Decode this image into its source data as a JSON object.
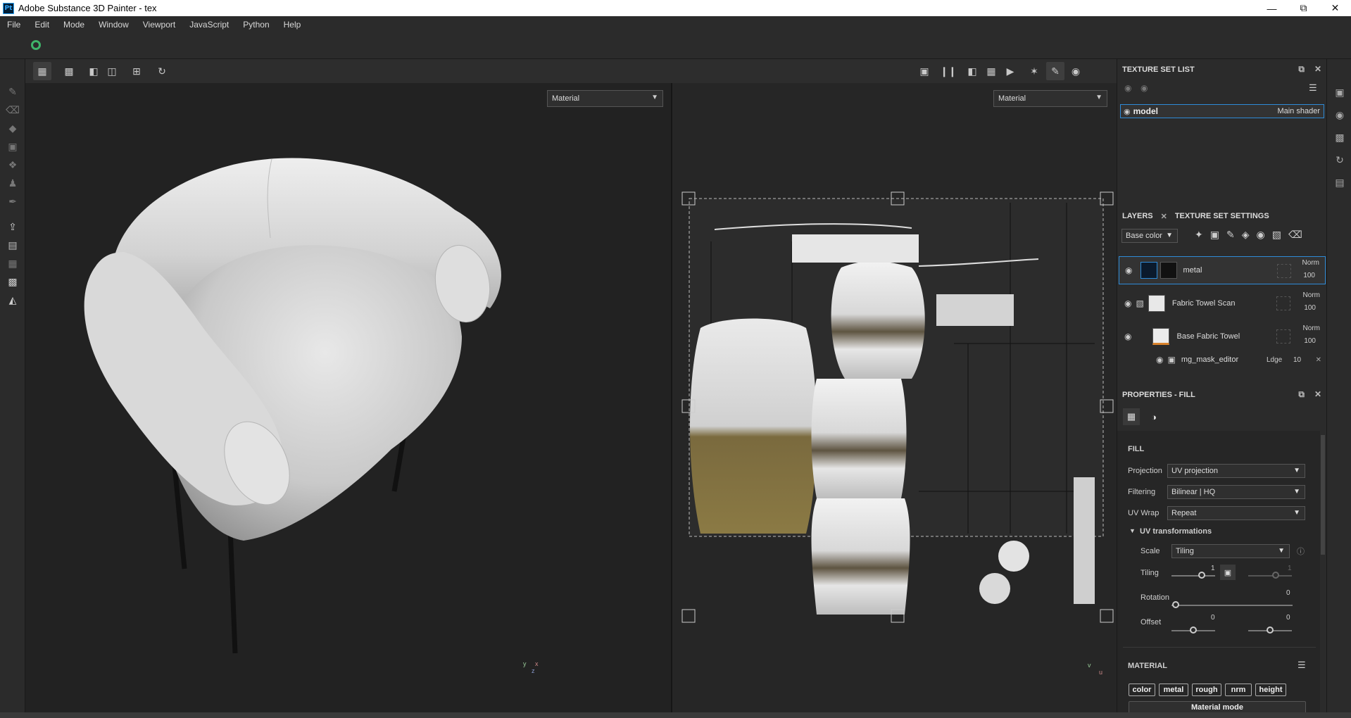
{
  "window": {
    "title": "Adobe Substance 3D Painter - tex",
    "app_badge": "Pt"
  },
  "menu": [
    "File",
    "Edit",
    "Mode",
    "Window",
    "Viewport",
    "JavaScript",
    "Python",
    "Help"
  ],
  "viewport": {
    "left_mode": "Material",
    "right_mode": "Material"
  },
  "texture_set_list": {
    "title": "TEXTURE SET LIST",
    "set": {
      "name": "model",
      "shader": "Main shader"
    }
  },
  "layers": {
    "tab_layers": "LAYERS",
    "tab_settings": "TEXTURE SET SETTINGS",
    "channel": "Base color",
    "items": [
      {
        "name": "metal",
        "blend": "Norm",
        "opacity": "100"
      },
      {
        "name": "Fabric Towel Scan",
        "blend": "Norm",
        "opacity": "100"
      },
      {
        "name": "Base Fabric Towel",
        "blend": "Norm",
        "opacity": "100"
      }
    ],
    "effect": {
      "name": "mg_mask_editor",
      "blend": "Ldge",
      "opacity": "10"
    }
  },
  "properties": {
    "title": "PROPERTIES - FILL",
    "section": "FILL",
    "projection_label": "Projection",
    "projection": "UV projection",
    "filtering_label": "Filtering",
    "filtering": "Bilinear | HQ",
    "uvwrap_label": "UV Wrap",
    "uvwrap": "Repeat",
    "uvt_title": "UV transformations",
    "scale_label": "Scale",
    "scale": "Tiling",
    "tiling_label": "Tiling",
    "tiling_value": "1",
    "tiling_value2": "1",
    "rotation_label": "Rotation",
    "rotation_value": "0",
    "offset_label": "Offset",
    "offset_x": "0",
    "offset_y": "0",
    "material_title": "MATERIAL",
    "channels": [
      "color",
      "metal",
      "rough",
      "nrm",
      "height"
    ],
    "material_mode": "Material mode"
  },
  "axes": {
    "x": "x",
    "y": "y",
    "z": "z",
    "u": "u",
    "v": "v"
  }
}
